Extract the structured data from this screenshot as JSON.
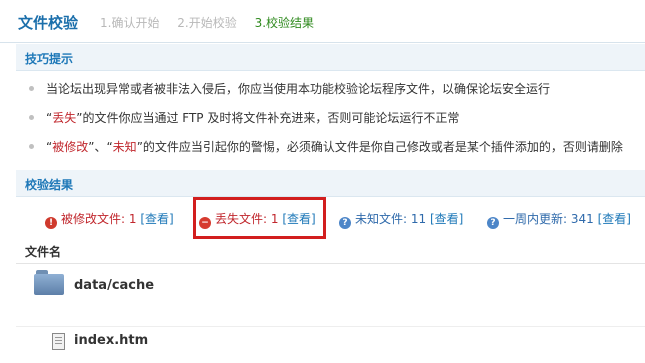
{
  "header": {
    "title": "文件校验",
    "steps": [
      "1.确认开始",
      "2.开始校验",
      "3.校验结果"
    ]
  },
  "tips": {
    "heading": "技巧提示",
    "items": [
      {
        "parts": [
          "当论坛出现异常或者被非法入侵后，你应当使用本功能校验论坛程序文件，以确保论坛安全运行"
        ]
      },
      {
        "parts": [
          "“",
          "丢失",
          "”的文件你应当通过 FTP 及时将文件补充进来，否则可能论坛运行不正常"
        ]
      },
      {
        "parts": [
          "“",
          "被修改",
          "”、“",
          "未知",
          "”的文件应当引起你的警惕，必须确认文件是你自己修改或者是某个插件添加的，否则请删除"
        ]
      }
    ]
  },
  "results": {
    "heading": "校验结果",
    "modified": {
      "label": "被修改文件:",
      "count": "1",
      "view": "[查看]"
    },
    "missing": {
      "label": "丢失文件:",
      "count": "1",
      "view": "[查看]"
    },
    "unknown": {
      "label": "未知文件:",
      "count": "11",
      "view": "[查看]"
    },
    "recent": {
      "label": "一周内更新:",
      "count": "341",
      "view": "[查看]"
    }
  },
  "file_list": {
    "column_header": "文件名",
    "rows": [
      {
        "name": "data/cache",
        "icon": "folder-icon"
      },
      {
        "name": "index.htm",
        "icon": "file-icon"
      }
    ]
  },
  "colors": {
    "accent": "#1e78b8",
    "highlight": "#d21e1e",
    "warning": "#c1272d"
  }
}
